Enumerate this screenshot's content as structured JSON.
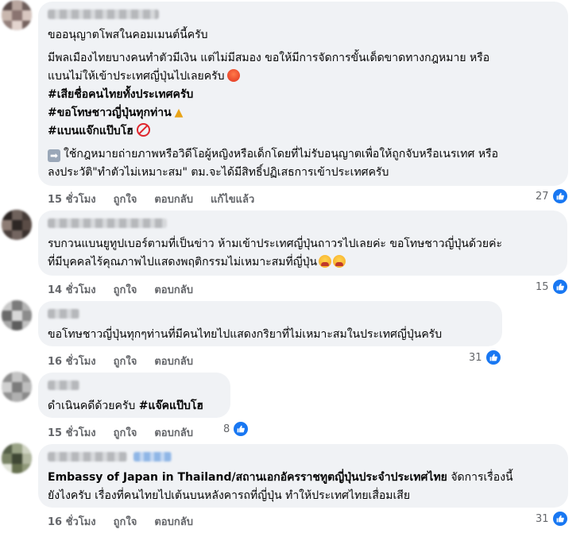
{
  "comments": [
    {
      "paragraphs": [
        "ขออนุญาตโพสในคอมเมนต์นี้ครับ",
        "มีพลเมืองไทยบางคนทำตัวมีเงิน แต่ไม่มีสมอง ขอให้มีการจัดการขั้นเด็ดขาดทางกฎหมาย หรือ",
        "แบนไม่ให้เข้าประเทศญี่ปุ่นไปเลยครับ",
        "#เสียชื่อคนไทยทั้งประเทศครับ",
        "#ขอโทษชาวญี่ปุ่นทุกท่าน",
        "#แบนแจ๊กแป๊บโฮ",
        "ใช้กฎหมายถ่ายภาพหรือวิดีโอผู้หญิงหรือเด็กโดยที่ไม่รับอนุญาตเพื่อให้ถูกจับหรือเนรเทศ หรือ",
        "ลงประวัติ\"ทำตัวไม่เหมาะสม\" ตม.จะได้มีสิทธิ์ปฏิเสธการเข้าประเทศครับ"
      ],
      "time": "15 ชั่วโมง",
      "like": "ถูกใจ",
      "reply": "ตอบกลับ",
      "edited": "แก้ไขแล้ว",
      "reactions": "27"
    },
    {
      "lines": [
        "รบกวนแบนยูทูปเบอร์ตามที่เป็นข่าว ห้ามเข้าประเทศญี่ปุ่นถาวรไปเลยค่ะ ขอโทษชาวญี่ปุ่นด้วยค่ะ",
        "ที่มีบุคคลไร้คุณภาพไปแสดงพฤติกรรมไม่เหมาะสมที่ญี่ปุ่น"
      ],
      "time": "14 ชั่วโมง",
      "like": "ถูกใจ",
      "reply": "ตอบกลับ",
      "reactions": "15"
    },
    {
      "lines": [
        "ขอโทษชาวญี่ปุ่นทุกๆท่านที่มีคนไทยไปแสดงกริยาที่ไม่เหมาะสมในประเทศญี่ปุ่นครับ"
      ],
      "time": "16 ชั่วโมง",
      "like": "ถูกใจ",
      "reply": "ตอบกลับ",
      "reactions": "31"
    },
    {
      "text_plain": "ดำเนินคดีด้วยครับ ",
      "hashtag": "#แจ๊คแป๊บโฮ",
      "time": "15 ชั่วโมง",
      "like": "ถูกใจ",
      "reply": "ตอบกลับ",
      "reactions": "8"
    },
    {
      "mention": "Embassy of Japan in Thailand/สถานเอกอัครราชทูตญี่ปุ่นประจำประเทศไทย",
      "line1_rest": " จัดการเรื่องนี้",
      "line2": "ยังไงครับ เรื่องที่คนไทยไปเต้นบนหลังคารถที่ญี่ปุ่น ทำให้ประเทศไทยเสื่อมเสีย",
      "time": "16 ชั่วโมง",
      "like": "ถูกใจ",
      "reply": "ตอบกลับ",
      "reactions": "31"
    }
  ],
  "colors": {
    "like_blue": "#1877f2",
    "bubble": "#f0f2f5",
    "meta": "#65676b"
  },
  "icons": [
    "like-icon",
    "angry-face-icon",
    "folded-hands-icon",
    "no-entry-icon",
    "right-arrow-icon",
    "crying-face-icon"
  ]
}
